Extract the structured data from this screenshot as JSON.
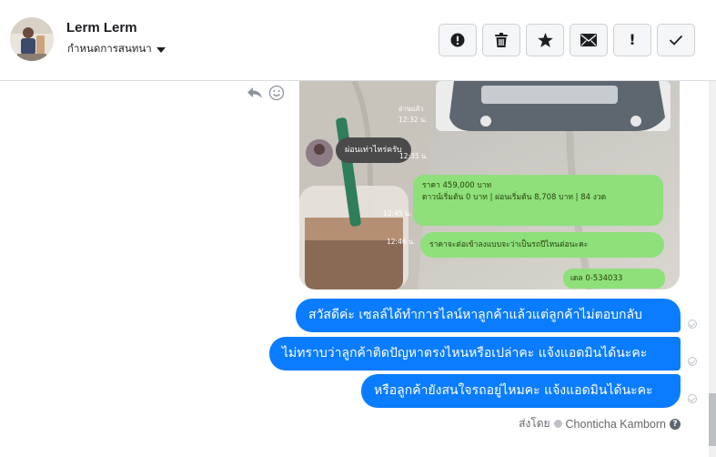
{
  "header": {
    "contact_name": "Lerm Lerm",
    "assign_label": "กำหนดการสนทนา",
    "toolbar": [
      {
        "icon": "spam-icon",
        "label": "Mark as spam"
      },
      {
        "icon": "trash-icon",
        "label": "Delete"
      },
      {
        "icon": "star-icon",
        "label": "Star"
      },
      {
        "icon": "envelope-icon",
        "label": "Mark as unread"
      },
      {
        "icon": "exclamation-icon",
        "label": "!"
      },
      {
        "icon": "checkmark-icon",
        "label": "Mark as done"
      }
    ]
  },
  "attachment": {
    "screenshot_texts": {
      "read_label": "อ่านแล้ว",
      "time1": "12:32 น.",
      "incoming_text": "ผ่อนเท่าไหร่ครับ",
      "time2": "12:35 น.",
      "price_line1": "ราคา 459,000 บาท",
      "price_line2": "ดาวน์เริ่มต้น 0 บาท | ผ่อนเริ่มต้น 8,708 บาท | 84 งวด",
      "time3": "12:45 น.",
      "reply_line": "ราคาจะต่อเข้าลงแบบจะว่าเป็นรถปีไหนต่อนะคะ",
      "time4": "12:46 น.",
      "phone_line": "เดล 0-534033"
    }
  },
  "messages": [
    {
      "text": "สวัสดีค่ะ เซลล์ได้ทำการไลน์หาลูกค้าแล้วแต่ลูกค้าไม่ตอบกลับ"
    },
    {
      "text": "ไม่ทราบว่าลูกค้าติดปัญหาตรงไหนหรือเปล่าคะ แจ้งแอดมินได้นะคะ"
    },
    {
      "text": "หรือลูกค้ายังสนใจรถอยู่ไหมคะ แจ้งแอดมินได้นะคะ"
    }
  ],
  "footer": {
    "sent_by_label": "ส่งโดย",
    "sender_name": "Chonticha Kamborn",
    "help": "?"
  },
  "colors": {
    "bubble": "#0a7cff",
    "line_green": "#8ee07a"
  }
}
